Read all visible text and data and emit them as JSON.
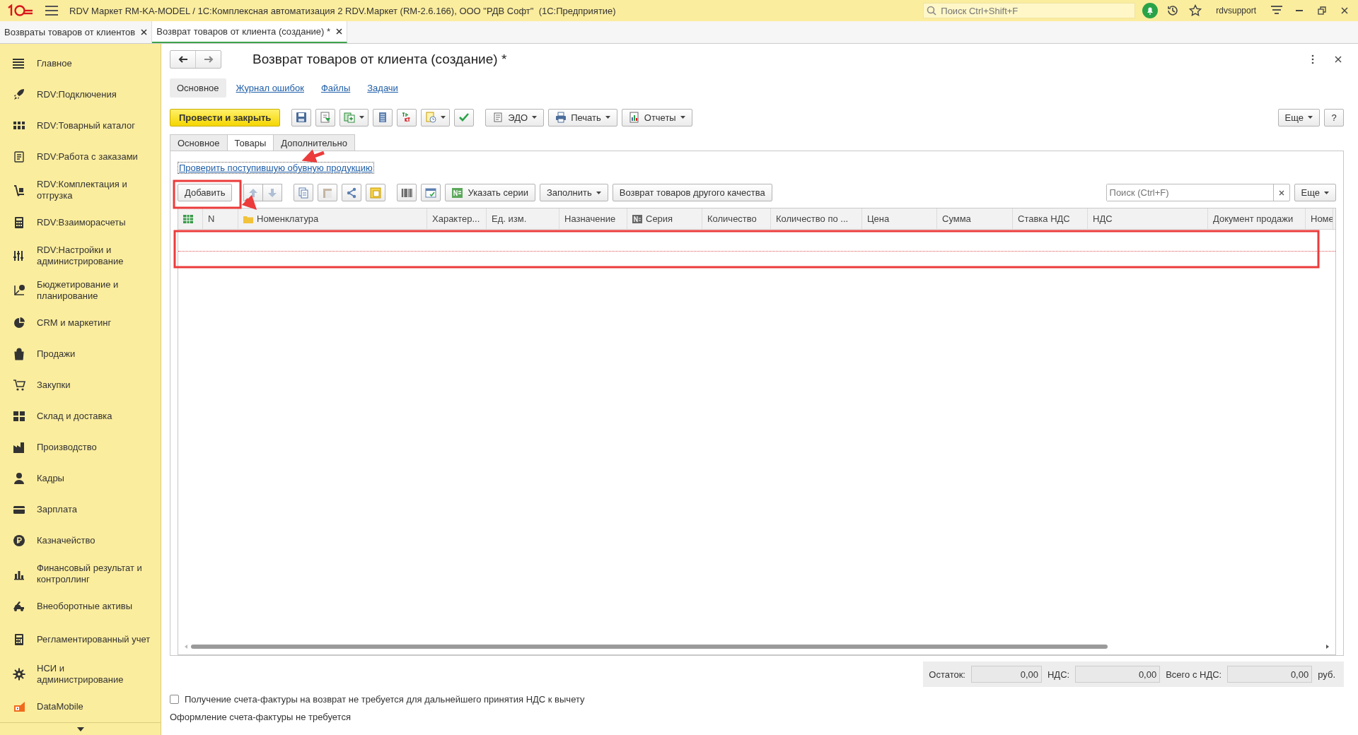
{
  "app_bar": {
    "title": "RDV Маркет RM-KA-MODEL / 1С:Комплексная автоматизация 2 RDV.Маркет (RM-2.6.166), ООО \"РДВ Софт\"  (1С:Предприятие)",
    "search_placeholder": "Поиск Ctrl+Shift+F",
    "user": "rdvsupport"
  },
  "open_tabs": [
    {
      "label": "Возвраты товаров от клиентов",
      "selected": false
    },
    {
      "label": "Возврат товаров от клиента (создание) *",
      "selected": true
    }
  ],
  "sidebar": {
    "items": [
      {
        "label": "Главное"
      },
      {
        "label": "RDV:Подключения"
      },
      {
        "label": "RDV:Товарный каталог"
      },
      {
        "label": "RDV:Работа с заказами"
      },
      {
        "label": "RDV:Комплектация и отгрузка"
      },
      {
        "label": "RDV:Взаиморасчеты"
      },
      {
        "label": "RDV:Настройки и администрирование"
      },
      {
        "label": "Бюджетирование и планирование"
      },
      {
        "label": "CRM и маркетинг"
      },
      {
        "label": "Продажи"
      },
      {
        "label": "Закупки"
      },
      {
        "label": "Склад и доставка"
      },
      {
        "label": "Производство"
      },
      {
        "label": "Кадры"
      },
      {
        "label": "Зарплата"
      },
      {
        "label": "Казначейство"
      },
      {
        "label": "Финансовый результат и контроллинг"
      },
      {
        "label": "Внеоборотные активы"
      },
      {
        "label": "Регламентированный учет"
      },
      {
        "label": "НСИ и администрирование"
      },
      {
        "label": "DataMobile"
      }
    ]
  },
  "form": {
    "title": "Возврат товаров от клиента (создание) *",
    "nav": [
      {
        "label": "Основное",
        "selected": true
      },
      {
        "label": "Журнал ошибок",
        "selected": false
      },
      {
        "label": "Файлы",
        "selected": false
      },
      {
        "label": "Задачи",
        "selected": false
      }
    ],
    "command_bar": [
      {
        "kind": "primary",
        "label": "Провести и закрыть"
      },
      {
        "kind": "icon",
        "menu": false
      },
      {
        "kind": "icon",
        "menu": false
      },
      {
        "kind": "icon",
        "menu": true
      },
      {
        "kind": "icon",
        "menu": false
      },
      {
        "kind": "icon",
        "menu": false
      },
      {
        "kind": "icon",
        "menu": true
      },
      {
        "kind": "icon",
        "menu": false
      },
      {
        "kind": "text",
        "label": "ЭДО",
        "menu": true
      },
      {
        "kind": "text",
        "label": "Печать",
        "menu": true
      },
      {
        "kind": "text",
        "label": "Отчеты",
        "menu": true
      }
    ],
    "more_button": "Еще",
    "help_button": "?",
    "tabs": [
      {
        "label": "Основное",
        "selected": false
      },
      {
        "label": "Товары",
        "selected": true
      },
      {
        "label": "Дополнительно",
        "selected": false
      }
    ],
    "check_link": "Проверить поступившую обувную продукцию",
    "table_toolbar": [
      {
        "kind": "text",
        "label": "Добавить",
        "menu": false
      },
      {
        "kind": "icon",
        "disabled": true
      },
      {
        "kind": "icon",
        "disabled": true
      },
      {
        "kind": "icon",
        "disabled": false
      },
      {
        "kind": "icon",
        "disabled": true
      },
      {
        "kind": "icon",
        "disabled": false
      },
      {
        "kind": "icon",
        "disabled": false
      },
      {
        "kind": "icon",
        "disabled": false
      },
      {
        "kind": "icon",
        "disabled": false
      },
      {
        "kind": "text",
        "label": "Указать серии",
        "menu": false
      },
      {
        "kind": "text",
        "label": "Заполнить",
        "menu": true
      },
      {
        "kind": "text",
        "label": "Возврат товаров другого качества",
        "menu": false
      }
    ],
    "table_search_placeholder": "Поиск (Ctrl+F)",
    "table_more_button": "Еще",
    "table": {
      "columns": [
        {},
        {
          "label": "N"
        },
        {
          "label": "Номенклатура"
        },
        {
          "label": "Характер..."
        },
        {
          "label": "Ед. изм."
        },
        {
          "label": "Назначение"
        },
        {
          "label": "Серия"
        },
        {
          "label": "Количество"
        },
        {
          "label": "Количество по ..."
        },
        {
          "label": "Цена"
        },
        {
          "label": "Сумма"
        },
        {
          "label": "Ставка НДС"
        },
        {
          "label": "НДС"
        },
        {
          "label": "Документ продажи"
        },
        {
          "label": "Номе"
        }
      ]
    },
    "totals": [
      {
        "label": "Остаток:",
        "value": "0,00"
      },
      {
        "label": "НДС:",
        "value": "0,00"
      },
      {
        "label": "Всего с НДС:",
        "value": "0,00"
      }
    ],
    "currency": "руб.",
    "invoice_checkbox": {
      "label": "Получение счета-фактуры на возврат не требуется для дальнейшего принятия НДС к вычету",
      "checked": false
    },
    "invoice_note": "Оформление счета-фактуры не требуется"
  }
}
